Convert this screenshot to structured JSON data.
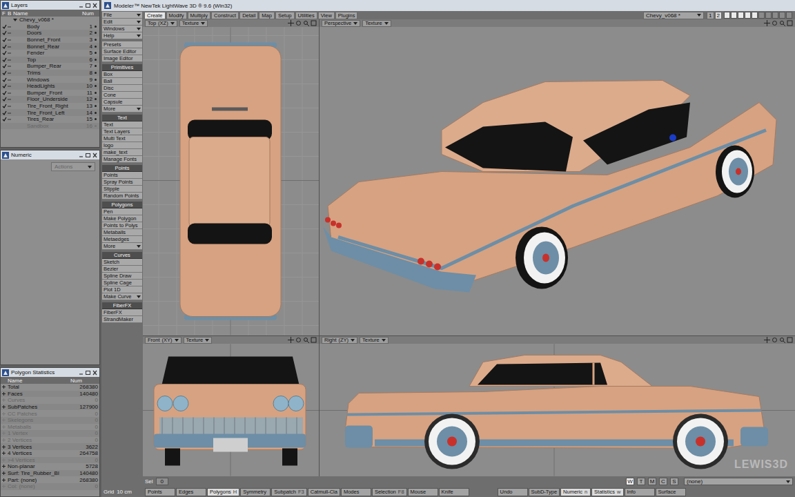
{
  "app": {
    "title": "Modeler™ NewTek LightWave 3D ® 9.6 (Win32)"
  },
  "layers_panel": {
    "title": "Layers",
    "columns": [
      "F",
      "B",
      "Name",
      "Num"
    ],
    "object": {
      "name": "Chevy_v068 *",
      "expanded": true
    },
    "rows": [
      {
        "name": "Body",
        "num": "1",
        "visible": true,
        "enabled": true
      },
      {
        "name": "Doors",
        "num": "2",
        "visible": true,
        "enabled": true
      },
      {
        "name": "Bonnet_Front",
        "num": "3",
        "visible": true,
        "enabled": true
      },
      {
        "name": "Bonnet_Rear",
        "num": "4",
        "visible": true,
        "enabled": true
      },
      {
        "name": "Fender",
        "num": "5",
        "visible": true,
        "enabled": true
      },
      {
        "name": "Top",
        "num": "6",
        "visible": true,
        "enabled": true
      },
      {
        "name": "Bumper_Rear",
        "num": "7",
        "visible": true,
        "enabled": true
      },
      {
        "name": "Trims",
        "num": "8",
        "visible": true,
        "enabled": true
      },
      {
        "name": "Windows",
        "num": "9",
        "visible": true,
        "enabled": true
      },
      {
        "name": "HeadLights",
        "num": "10",
        "visible": true,
        "enabled": true
      },
      {
        "name": "Bumper_Front",
        "num": "11",
        "visible": true,
        "enabled": true
      },
      {
        "name": "Floor_Underside",
        "num": "12",
        "visible": true,
        "enabled": true
      },
      {
        "name": "Tire_Front_Right",
        "num": "13",
        "visible": true,
        "enabled": true
      },
      {
        "name": "Tire_Front_Left",
        "num": "14",
        "visible": true,
        "enabled": true
      },
      {
        "name": "Tires_Rear",
        "num": "15",
        "visible": true,
        "enabled": true
      },
      {
        "name": "Sandbox",
        "num": "16",
        "visible": false,
        "enabled": false
      }
    ]
  },
  "numeric_panel": {
    "title": "Numeric",
    "dropdown": {
      "label": "Actions",
      "disabled": true
    }
  },
  "stats_panel": {
    "title": "Polygon Statistics",
    "columns": [
      "Name",
      "Num"
    ],
    "rows": [
      {
        "name": "Total",
        "num": "268380",
        "enabled": true
      },
      {
        "name": "Faces",
        "num": "140480",
        "enabled": true
      },
      {
        "name": "Curves",
        "num": "0",
        "enabled": false
      },
      {
        "name": "SubPatches",
        "num": "127900",
        "enabled": true
      },
      {
        "name": "CC Patches",
        "num": "0",
        "enabled": false
      },
      {
        "name": "Skelegons",
        "num": "0",
        "enabled": false
      },
      {
        "name": "Metaballs",
        "num": "0",
        "enabled": false
      },
      {
        "name": "1 Vertex",
        "num": "0",
        "enabled": false
      },
      {
        "name": "2 Vertices",
        "num": "0",
        "enabled": false
      },
      {
        "name": "3 Vertices",
        "num": "3622",
        "enabled": true
      },
      {
        "name": "4 Vertices",
        "num": "264758",
        "enabled": true
      },
      {
        "name": ">4 Vertices",
        "num": "0",
        "enabled": false
      },
      {
        "name": "Non-planar",
        "num": "5728",
        "enabled": true
      },
      {
        "name": "Surf: Tire_Rubber_Bl",
        "num": "140480",
        "enabled": true
      },
      {
        "name": "Part: (none)",
        "num": "268380",
        "enabled": true
      },
      {
        "name": "Col: (none)",
        "num": "0",
        "enabled": false
      }
    ]
  },
  "toolbar": {
    "menus": [
      "File",
      "Edit",
      "Windows",
      "Help"
    ],
    "tools": [
      "Presets",
      "Surface Editor",
      "Image Editor"
    ],
    "groups": [
      {
        "title": "Primitives",
        "items": [
          {
            "label": "Box",
            "kind": "button"
          },
          {
            "label": "Ball",
            "kind": "button"
          },
          {
            "label": "Disc",
            "kind": "button"
          },
          {
            "label": "Cone",
            "kind": "button"
          },
          {
            "label": "Capsule",
            "kind": "button"
          },
          {
            "label": "More",
            "kind": "menu"
          }
        ]
      },
      {
        "title": "Text",
        "items": [
          {
            "label": "Text",
            "kind": "button"
          },
          {
            "label": "Text Layers",
            "kind": "button"
          },
          {
            "label": "Multi Text",
            "kind": "button"
          },
          {
            "label": "logo",
            "kind": "button"
          },
          {
            "label": "make_text",
            "kind": "button"
          },
          {
            "label": "Manage Fonts",
            "kind": "button"
          }
        ]
      },
      {
        "title": "Points",
        "items": [
          {
            "label": "Points",
            "kind": "button"
          },
          {
            "label": "Spray Points",
            "kind": "button"
          },
          {
            "label": "Stipple",
            "kind": "button"
          },
          {
            "label": "Random Points",
            "kind": "button"
          }
        ]
      },
      {
        "title": "Polygons",
        "items": [
          {
            "label": "Pen",
            "kind": "button"
          },
          {
            "label": "Make Polygon",
            "kind": "button"
          },
          {
            "label": "Points to Polys",
            "kind": "button"
          },
          {
            "label": "Metaballs",
            "kind": "button"
          },
          {
            "label": "Metaedges",
            "kind": "button"
          },
          {
            "label": "More",
            "kind": "menu"
          }
        ]
      },
      {
        "title": "Curves",
        "items": [
          {
            "label": "Sketch",
            "kind": "button"
          },
          {
            "label": "Bezier",
            "kind": "button"
          },
          {
            "label": "Spline Draw",
            "kind": "button"
          },
          {
            "label": "Spline Cage",
            "kind": "button"
          },
          {
            "label": "Plot 1D",
            "kind": "button"
          },
          {
            "label": "Make Curve",
            "kind": "menu"
          }
        ]
      },
      {
        "title": "FiberFX",
        "items": [
          {
            "label": "FiberFX",
            "kind": "button"
          },
          {
            "label": "StrandMaker",
            "kind": "button"
          }
        ]
      }
    ]
  },
  "tabs": [
    {
      "label": "Create",
      "selected": true
    },
    {
      "label": "Modify",
      "selected": false
    },
    {
      "label": "Multiply",
      "selected": false
    },
    {
      "label": "Construct",
      "selected": false
    },
    {
      "label": "Detail",
      "selected": false
    },
    {
      "label": "Map",
      "selected": false
    },
    {
      "label": "Setup",
      "selected": false
    },
    {
      "label": "Utilities",
      "selected": false
    },
    {
      "label": "View",
      "selected": false
    },
    {
      "label": "Plugins",
      "selected": false
    }
  ],
  "object_selector": "Chevy_v068 *",
  "layer_bank": [
    {
      "label": "1",
      "selected": false
    },
    {
      "label": "2",
      "selected": true
    }
  ],
  "layer_slots": [
    {
      "filled": true
    },
    {
      "filled": true
    },
    {
      "filled": true
    },
    {
      "filled": true
    },
    {
      "filled": true
    },
    {
      "filled": false
    },
    {
      "filled": false
    },
    {
      "filled": false
    },
    {
      "filled": false
    },
    {
      "filled": false
    }
  ],
  "viewports": [
    {
      "name": "Top",
      "axes": "(XZ)",
      "mode": "Texture",
      "kind": "top"
    },
    {
      "name": "Perspective",
      "mode": "Texture",
      "kind": "perspective"
    },
    {
      "name": "Front",
      "axes": "(XY)",
      "mode": "Texture",
      "kind": "front"
    },
    {
      "name": "Right",
      "axes": "(ZY)",
      "mode": "Texture",
      "kind": "side"
    }
  ],
  "status_bar": {
    "sel_label": "Sel",
    "sel_value": "0",
    "grid_label": "Grid",
    "grid_value": "10 cm",
    "view_flags": [
      {
        "label": "W",
        "selected": true
      },
      {
        "label": "T",
        "selected": false
      },
      {
        "label": "M",
        "selected": false
      },
      {
        "label": "C",
        "selected": false
      },
      {
        "label": "S",
        "selected": false
      }
    ],
    "surface": "(none)",
    "buttons": [
      {
        "label": "Points",
        "key": "",
        "selected": false
      },
      {
        "label": "Edges",
        "key": "",
        "selected": false
      },
      {
        "label": "Polygons",
        "key": "H",
        "selected": true
      },
      {
        "label": "Symmetry",
        "key": "",
        "selected": false
      },
      {
        "label": "Subpatch",
        "key": "F3",
        "selected": false
      },
      {
        "label": "Catmull-Cla",
        "key": "",
        "selected": false
      },
      {
        "label": "Modes",
        "key": "",
        "selected": false
      },
      {
        "label": "Selection",
        "key": "F8",
        "selected": false
      },
      {
        "label": "Mouse",
        "key": "",
        "selected": false
      },
      {
        "label": "Knife",
        "key": "",
        "selected": false
      },
      {
        "label": "Undo",
        "key": "",
        "selected": false
      },
      {
        "label": "SubD-Type",
        "key": "",
        "selected": false
      },
      {
        "label": "Numeric",
        "key": "n",
        "selected": true
      },
      {
        "label": "Statistics",
        "key": "w",
        "selected": true
      },
      {
        "label": "Info",
        "key": "",
        "selected": false
      },
      {
        "label": "Surface",
        "key": "",
        "selected": false
      }
    ]
  },
  "watermark": "LEWIS3D"
}
